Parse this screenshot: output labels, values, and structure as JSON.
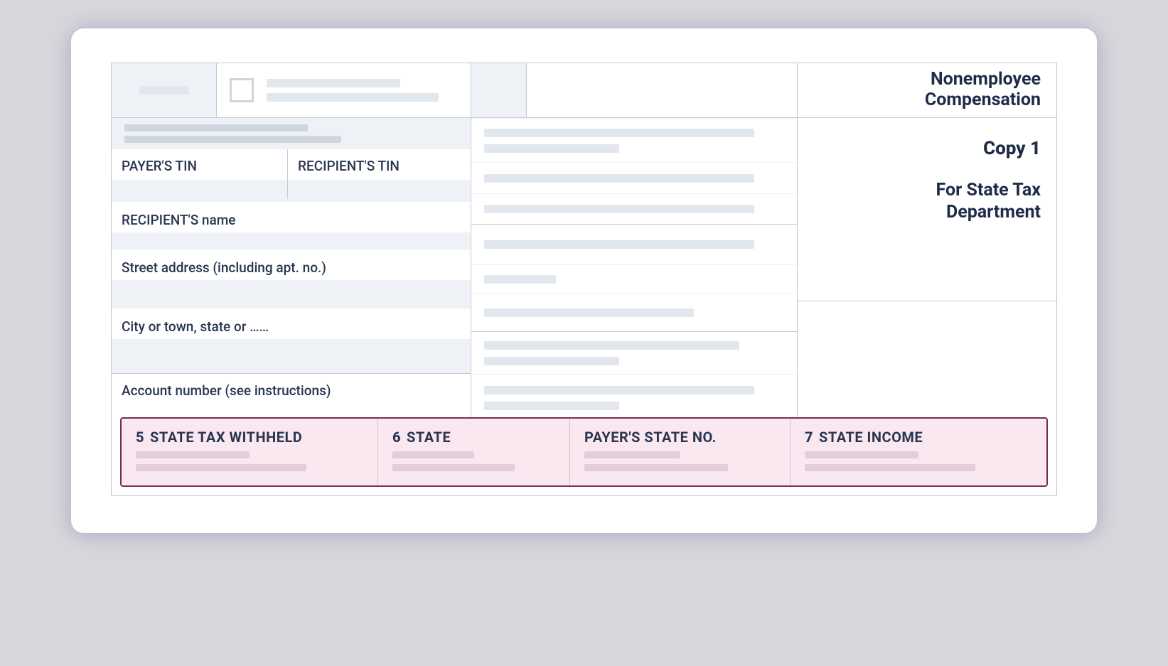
{
  "form_title": {
    "line1": "Nonemployee",
    "line2": "Compensation"
  },
  "copy_label": "Copy 1",
  "dept_line1": "For State Tax",
  "dept_line2": "Department",
  "left": {
    "payer_tin": "PAYER'S TIN",
    "recipient_tin": "RECIPIENT'S TIN",
    "recipient_name": "RECIPIENT'S name",
    "street": "Street address (including apt. no.)",
    "city": "City or town, state or ……",
    "account": "Account number (see instructions)"
  },
  "state_row": {
    "box5_num": "5",
    "box5_label": "STATE TAX WITHHELD",
    "box6_num": "6",
    "box6_label": "STATE",
    "payer_state_no": "PAYER'S STATE NO.",
    "box7_num": "7",
    "box7_label": "STATE INCOME"
  }
}
